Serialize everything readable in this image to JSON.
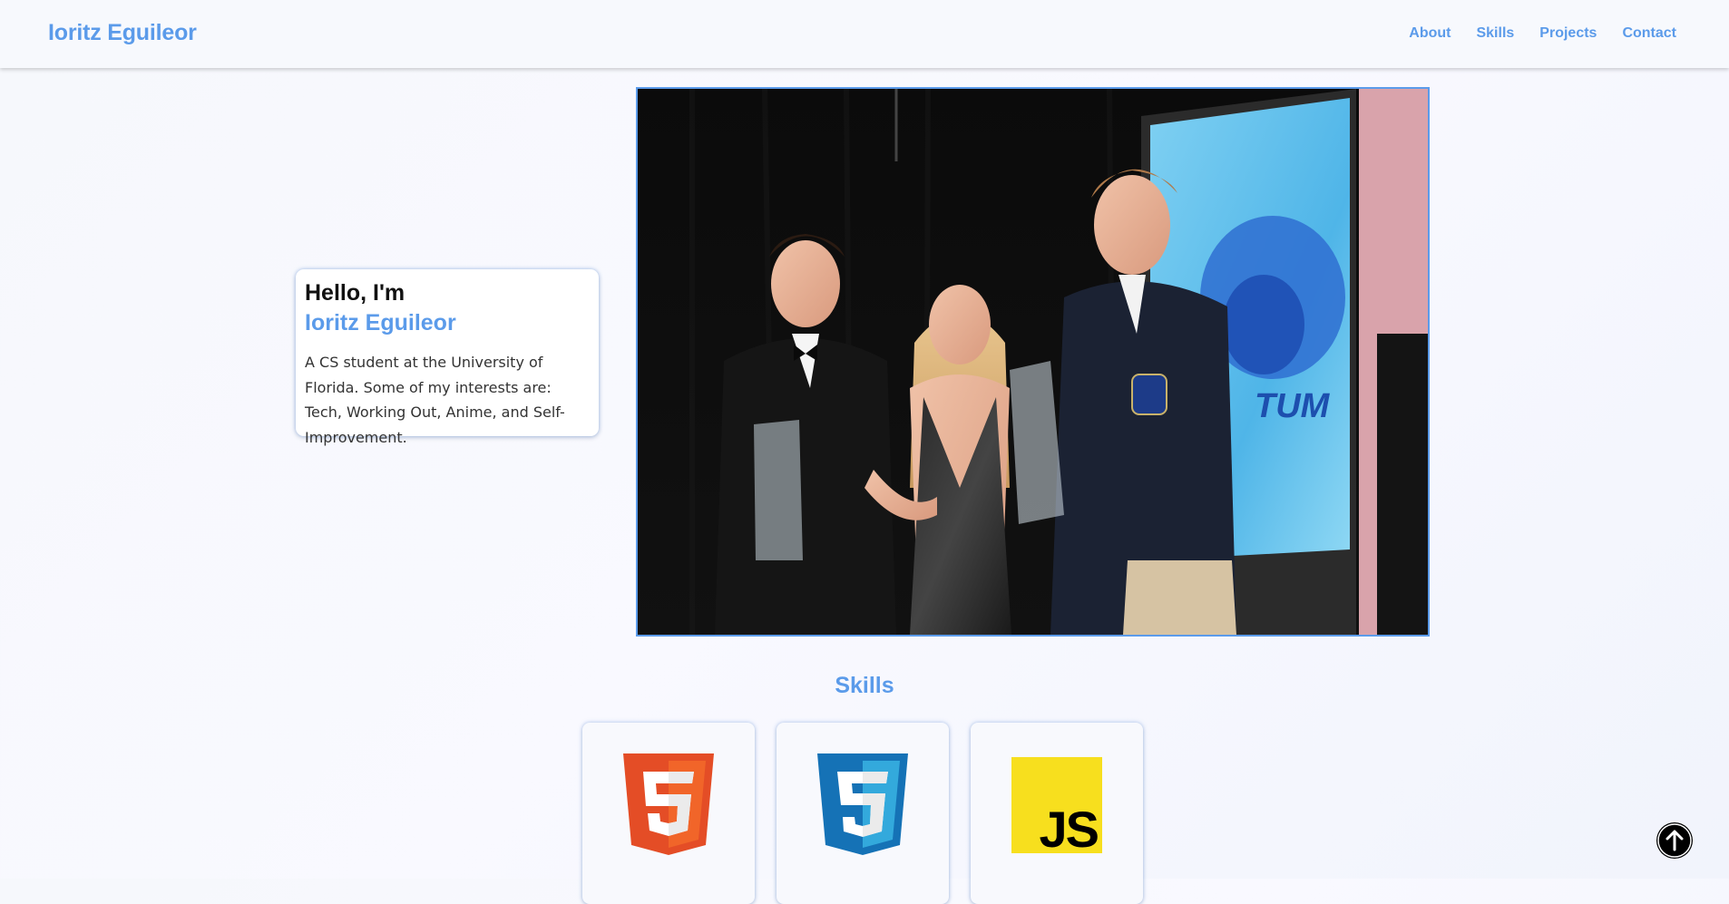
{
  "header": {
    "brand": "Ioritz Eguileor",
    "nav": [
      "About",
      "Skills",
      "Projects",
      "Contact"
    ]
  },
  "intro": {
    "greeting": "Hello, I'm",
    "name": "Ioritz Eguileor",
    "description": "A CS student at the University of Florida. Some of my interests are: Tech, Working Out, Anime, and Self-Improvement."
  },
  "hero_photo": {
    "icon": "portrait-photo"
  },
  "skills": {
    "title": "Skills",
    "items": [
      {
        "name": "HTML5",
        "icon": "html5-icon",
        "color": "#e44d26",
        "glyph": "5"
      },
      {
        "name": "CSS3",
        "icon": "css3-icon",
        "color": "#1572b6",
        "glyph": "3"
      },
      {
        "name": "JavaScript",
        "icon": "javascript-icon",
        "color": "#f7df1e",
        "glyph": "JS"
      }
    ]
  },
  "scroll_top": {
    "icon": "arrow-up-icon"
  },
  "colors": {
    "accent": "#5b9bea",
    "html": "#e44d26",
    "css": "#1572b6",
    "js": "#f7df1e"
  }
}
